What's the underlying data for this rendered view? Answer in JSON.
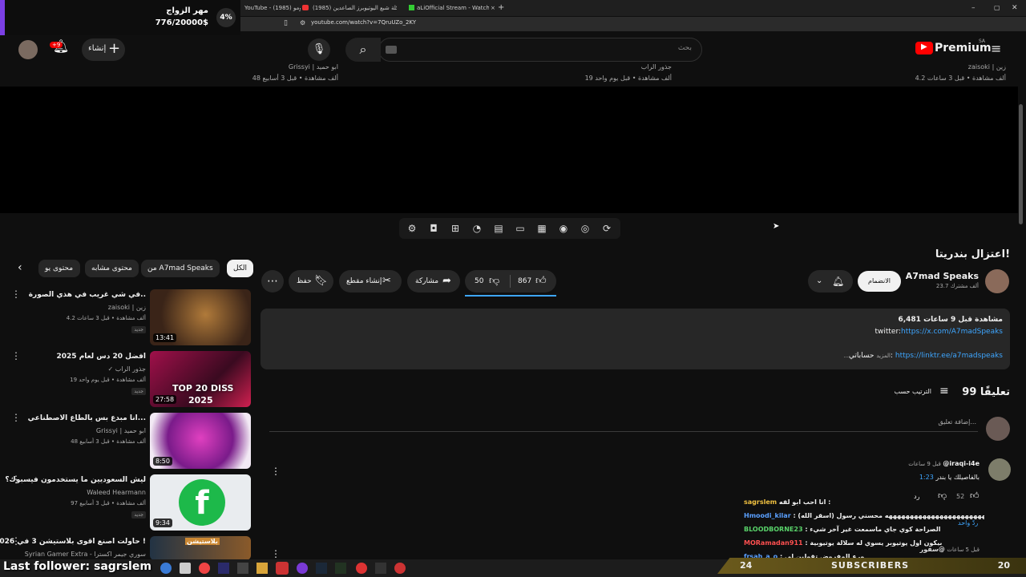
{
  "browser": {
    "tabs": [
      "YouTube - برومو (1985)",
      "(1985) مشكلة شبع اليوتيوبرز الصاعدين",
      "aLiOfficial Stream - Watch Live o"
    ],
    "url": "youtube.com/watch?v=7QruUZo_2KY"
  },
  "goal": {
    "title": "مهر الزواج",
    "amount": "776/20000$",
    "percent": "4%"
  },
  "header": {
    "logo": "Premium",
    "region": "SA",
    "search_placeholder": "بحث",
    "create_label": "إنشاء",
    "notif_badge": "+9"
  },
  "top_row": [
    {
      "channel": "Grissyi | ابو حميد",
      "meta": "48 ألف مشاهدة • قبل 3 أسابيع"
    },
    {
      "channel": "جذور الراب",
      "meta": "19 ألف مشاهدة • قبل يوم واحد"
    },
    {
      "channel": "zaisoki | زين",
      "meta": "4.2 ألف مشاهدة • قبل 3 ساعات"
    }
  ],
  "video": {
    "title": "اعتزال بندريتا!",
    "channel": "A7mad Speaks",
    "subs": "23.7 ألف مشترك",
    "join": "الانضمام",
    "likes": "867",
    "dislikes": "50",
    "share": "مشاركة",
    "clip": "إنشاء مقطع",
    "save": "حفظ"
  },
  "description": {
    "views_date": "6,481 مشاهدة  قبل 9 ساعات",
    "twitter_label": "twitter:",
    "twitter_url": "https://x.com/A7madSpeaks",
    "accounts_label": "حساباتي: ",
    "accounts_url": "https://linktr.ee/a7madspeaks",
    "more": "...المزيد"
  },
  "comments": {
    "count": "99 تعليقًا",
    "sort": "الترتيب حسب",
    "add": "إضافة تعليق...",
    "first": {
      "author": "@iraqi-i4e",
      "time": "قبل 9 ساعات",
      "timestamp": "1:23",
      "text": "بالفاصيلك يا بندر",
      "likes": "52",
      "reply": "رد"
    },
    "replies": "ردّ واحد",
    "second_author": "@سفور",
    "second_time": "قبل 5 ساعات"
  },
  "chips": [
    "الكل",
    "من A7mad Speaks",
    "محتوى مشابه",
    "محتوى يو"
  ],
  "sidebar": [
    {
      "title": "في شي غريب في هذي الصورة..",
      "channel": "zaisoki | زين",
      "meta": "4.2 ألف مشاهدة • قبل 3 ساعات",
      "badge": "جديد",
      "duration": "13:41"
    },
    {
      "title": "افضل 20 دس لعام 2025",
      "channel": "جذور الراب",
      "meta": "19 ألف مشاهدة • قبل يوم واحد",
      "badge": "جديد",
      "duration": "27:58",
      "thumb_text": "TOP 20 DISS",
      "thumb_year": "2025"
    },
    {
      "title": "انا مبدع بس بالطاع الاصطناعي...",
      "channel": "Grissyi | ابو حميد",
      "meta": "48 ألف مشاهدة • قبل 3 أسابيع",
      "duration": "8:50"
    },
    {
      "title": "ليش السعوديين ما يستخدمون فيسبوك؟",
      "channel": "Waleed Hearmann",
      "meta": "97 ألف مشاهدة • قبل 3 أسابيع",
      "badge": "جديد",
      "duration": "9:34"
    },
    {
      "title": "حاولت اصنع اقوى بلاستيشن 3 في 2026 !",
      "channel": "Syrian Gamer Extra - سوري جيمر اكسترا",
      "thumb_text": "بلاستيشن"
    }
  ],
  "chat": [
    {
      "user": "sagrslem",
      "msg": "انا احب ابو لقه :",
      "color": "#f0c040"
    },
    {
      "user": "Hmoodi_kilar",
      "msg": ": هههههههههههههههههههههههههههههه محسني رسول (اسقر الله)",
      "color": "#5aa0ff"
    },
    {
      "user": "BLOODBORNE23",
      "msg": ": الصراحة كوي جاي ماسمعت غير آخر شيء",
      "color": "#59d36a"
    },
    {
      "user": "MORamadan911",
      "msg": ": بيكون اول يوتيوبر يسوي له سلالة يوتيوبية",
      "color": "#ff5050"
    },
    {
      "user": "frsah_a_o",
      "msg": ": ورع المفروض تقولين لي",
      "color": "#5aa0ff"
    }
  ],
  "overlay": {
    "last_follower": "Last follower: sagrslem",
    "subs_label": "SUBSCRIBERS",
    "subs_left": "24",
    "subs_right": "20"
  }
}
